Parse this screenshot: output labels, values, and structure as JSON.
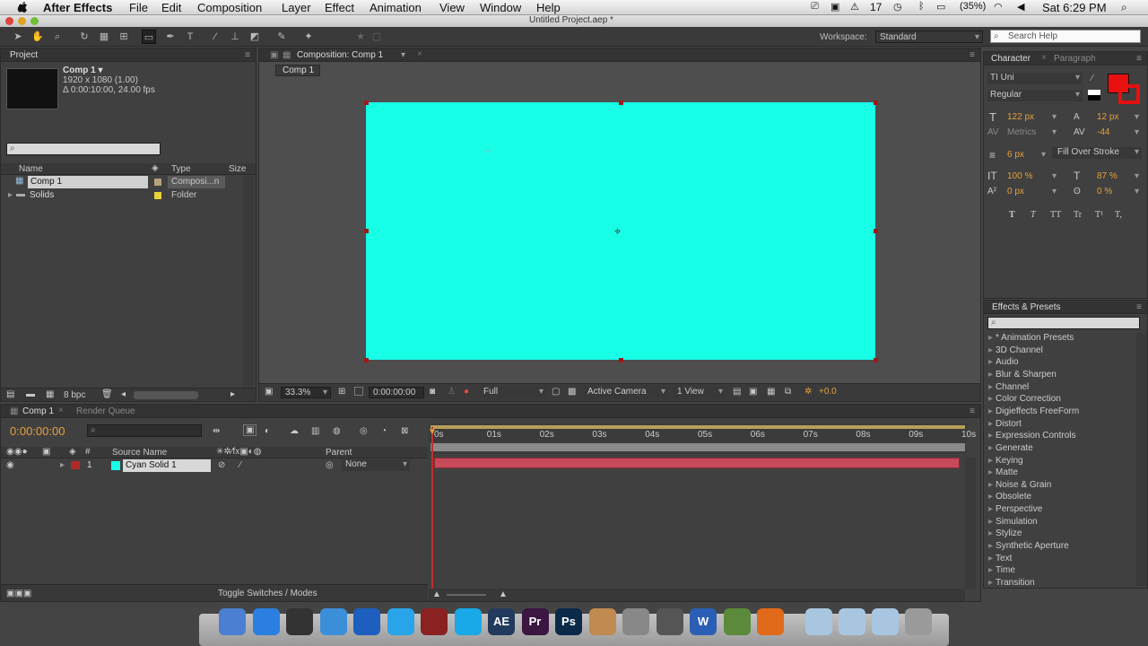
{
  "menubar": {
    "app_name": "After Effects",
    "items": [
      "File",
      "Edit",
      "Composition",
      "Layer",
      "Effect",
      "Animation",
      "View",
      "Window",
      "Help"
    ],
    "status": {
      "ai_version": "17",
      "battery": "(35%)",
      "clock": "Sat 6:29 PM"
    }
  },
  "window": {
    "title": "Untitled Project.aep *"
  },
  "toolbar": {
    "workspace_label": "Workspace:",
    "workspace_value": "Standard",
    "search_placeholder": "Search Help"
  },
  "project": {
    "tab": "Project",
    "comp_name": "Comp 1 ▾",
    "comp_res": "1920 x 1080 (1.00)",
    "comp_dur": "Δ 0:00:10:00, 24.00 fps",
    "columns": {
      "name": "Name",
      "type": "Type",
      "size": "Size"
    },
    "rows": [
      {
        "name": "Comp 1",
        "type": "Composi...n",
        "label_color": "#b5a27c"
      },
      {
        "name": "Solids",
        "type": "Folder",
        "label_color": "#e8d23a"
      }
    ],
    "bpc": "8 bpc"
  },
  "comp": {
    "tab": "Composition: Comp 1",
    "sub_tab": "Comp 1",
    "solid_color": "#18ffe7",
    "zoom": "33.3%",
    "time": "0:00:00:00",
    "quality": "Full",
    "camera": "Active Camera",
    "views": "1 View",
    "exposure": "+0.0"
  },
  "character": {
    "tab": "Character",
    "tab2": "Paragraph",
    "font": "TI Uni",
    "style": "Regular",
    "size": "122 px",
    "leading": "12 px",
    "kerning": "Metrics",
    "tracking": "-44",
    "stroke_width": "6 px",
    "stroke_mode": "Fill Over Stroke",
    "vscale": "100 %",
    "hscale": "87 %",
    "baseline": "0 px",
    "tsume": "0 %",
    "fill_color": "#e81010",
    "styles": [
      "T",
      "T",
      "TT",
      "Tr",
      "T¹",
      "T,"
    ]
  },
  "effects": {
    "tab": "Effects & Presets",
    "items": [
      "* Animation Presets",
      "3D Channel",
      "Audio",
      "Blur & Sharpen",
      "Channel",
      "Color Correction",
      "Digieffects FreeForm",
      "Distort",
      "Expression Controls",
      "Generate",
      "Keying",
      "Matte",
      "Noise & Grain",
      "Obsolete",
      "Perspective",
      "Simulation",
      "Stylize",
      "Synthetic Aperture",
      "Text",
      "Time",
      "Transition"
    ]
  },
  "timeline": {
    "tab": "Comp 1",
    "tab2": "Render Queue",
    "timecode": "0:00:00:00",
    "col_source": "Source Name",
    "col_parent": "Parent",
    "layer": {
      "num": "1",
      "name": "Cyan Solid 1",
      "parent": "None",
      "label_color": "#b02a2a",
      "swatch": "#18ffe7"
    },
    "ruler": [
      "0s",
      "01s",
      "02s",
      "03s",
      "04s",
      "05s",
      "06s",
      "07s",
      "08s",
      "09s",
      "10s"
    ],
    "toggle_label": "Toggle Switches / Modes"
  },
  "dock": {
    "apps": [
      "Finder",
      "App Store",
      "Dashboard",
      "Safari",
      "Globe",
      "iTunes",
      "Photo Booth",
      "Skype",
      "AE",
      "Pr",
      "Ps",
      "Cup",
      "Preview",
      "Tuner",
      "Word",
      "Minecraft",
      "Firefox"
    ]
  }
}
